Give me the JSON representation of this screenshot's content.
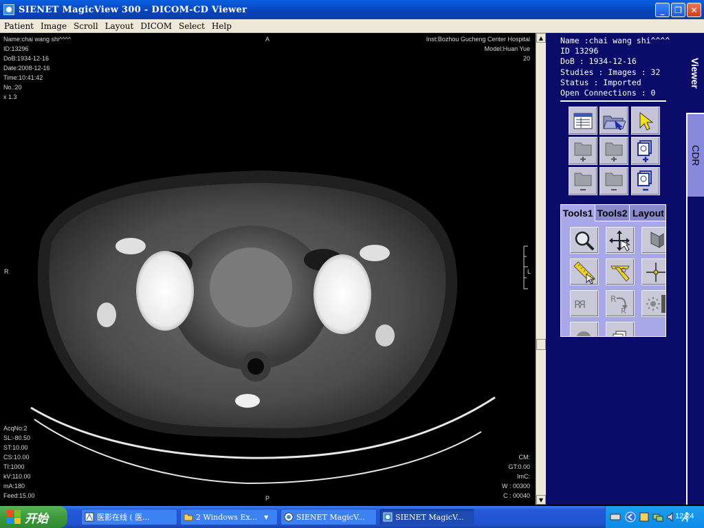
{
  "window": {
    "title": "SIENET MagicView 300  - DICOM-CD Viewer",
    "min_label": "_",
    "max_label": "❐",
    "close_label": "✕"
  },
  "menu": [
    {
      "label": "Patient"
    },
    {
      "label": "Image"
    },
    {
      "label": "Scroll"
    },
    {
      "label": "Layout"
    },
    {
      "label": "DICOM"
    },
    {
      "label": "Select"
    },
    {
      "label": "Help"
    }
  ],
  "overlay": {
    "top_left": [
      "Name:chai wang shi^^^^",
      "ID:13296",
      "DoB:1934-12-16",
      "Date:2008-12-16",
      "Time:10:41:42",
      "No.:20",
      "x 1.3"
    ],
    "top_right": [
      "Inst:Bozhou Gucheng Center Hospital",
      "Model:Huan Yue",
      "20"
    ],
    "bottom_left": [
      "AcqNo:2",
      "SL:-80.50",
      "ST:10.00",
      "CS:10.00",
      "TI:1000",
      "kV:110.00",
      "mA:180",
      "Feed:15.00"
    ],
    "bottom_right": [
      "CM:",
      "GT:0.00",
      "ImC:",
      "W : 00300",
      "C : 00040"
    ],
    "orient_top": "A",
    "orient_left": "R",
    "orient_bottom": "P",
    "orient_right": "L"
  },
  "scrollbar": {
    "up": "▲",
    "down": "▼"
  },
  "info": {
    "name": "Name :chai wang shi^^^^",
    "id": "ID 13296",
    "dob": "DoB : 1934-12-16",
    "studies": "Studies : Images : 32",
    "status": "Status : Imported",
    "connections": "Open Connections : 0"
  },
  "tools_tabs": {
    "tools1": "Tools1",
    "tools2": "Tools2",
    "layout": "Layout"
  },
  "side_tabs": {
    "viewer": "Viewer",
    "cdr": "CDR"
  },
  "taskbar": {
    "start": "开始",
    "tasks": [
      {
        "label": "医影在线 ( 医..."
      },
      {
        "label": "2 Windows Ex..."
      },
      {
        "label": "SIENET MagicV..."
      },
      {
        "label": "SIENET MagicV..."
      }
    ],
    "clock": "12:24"
  },
  "colors": {
    "panel_bg": "#0b0b6a",
    "tools_bg": "#a8a8e8",
    "cdr_tab": "#8888dd",
    "titlebar": "#0a5fe0"
  }
}
